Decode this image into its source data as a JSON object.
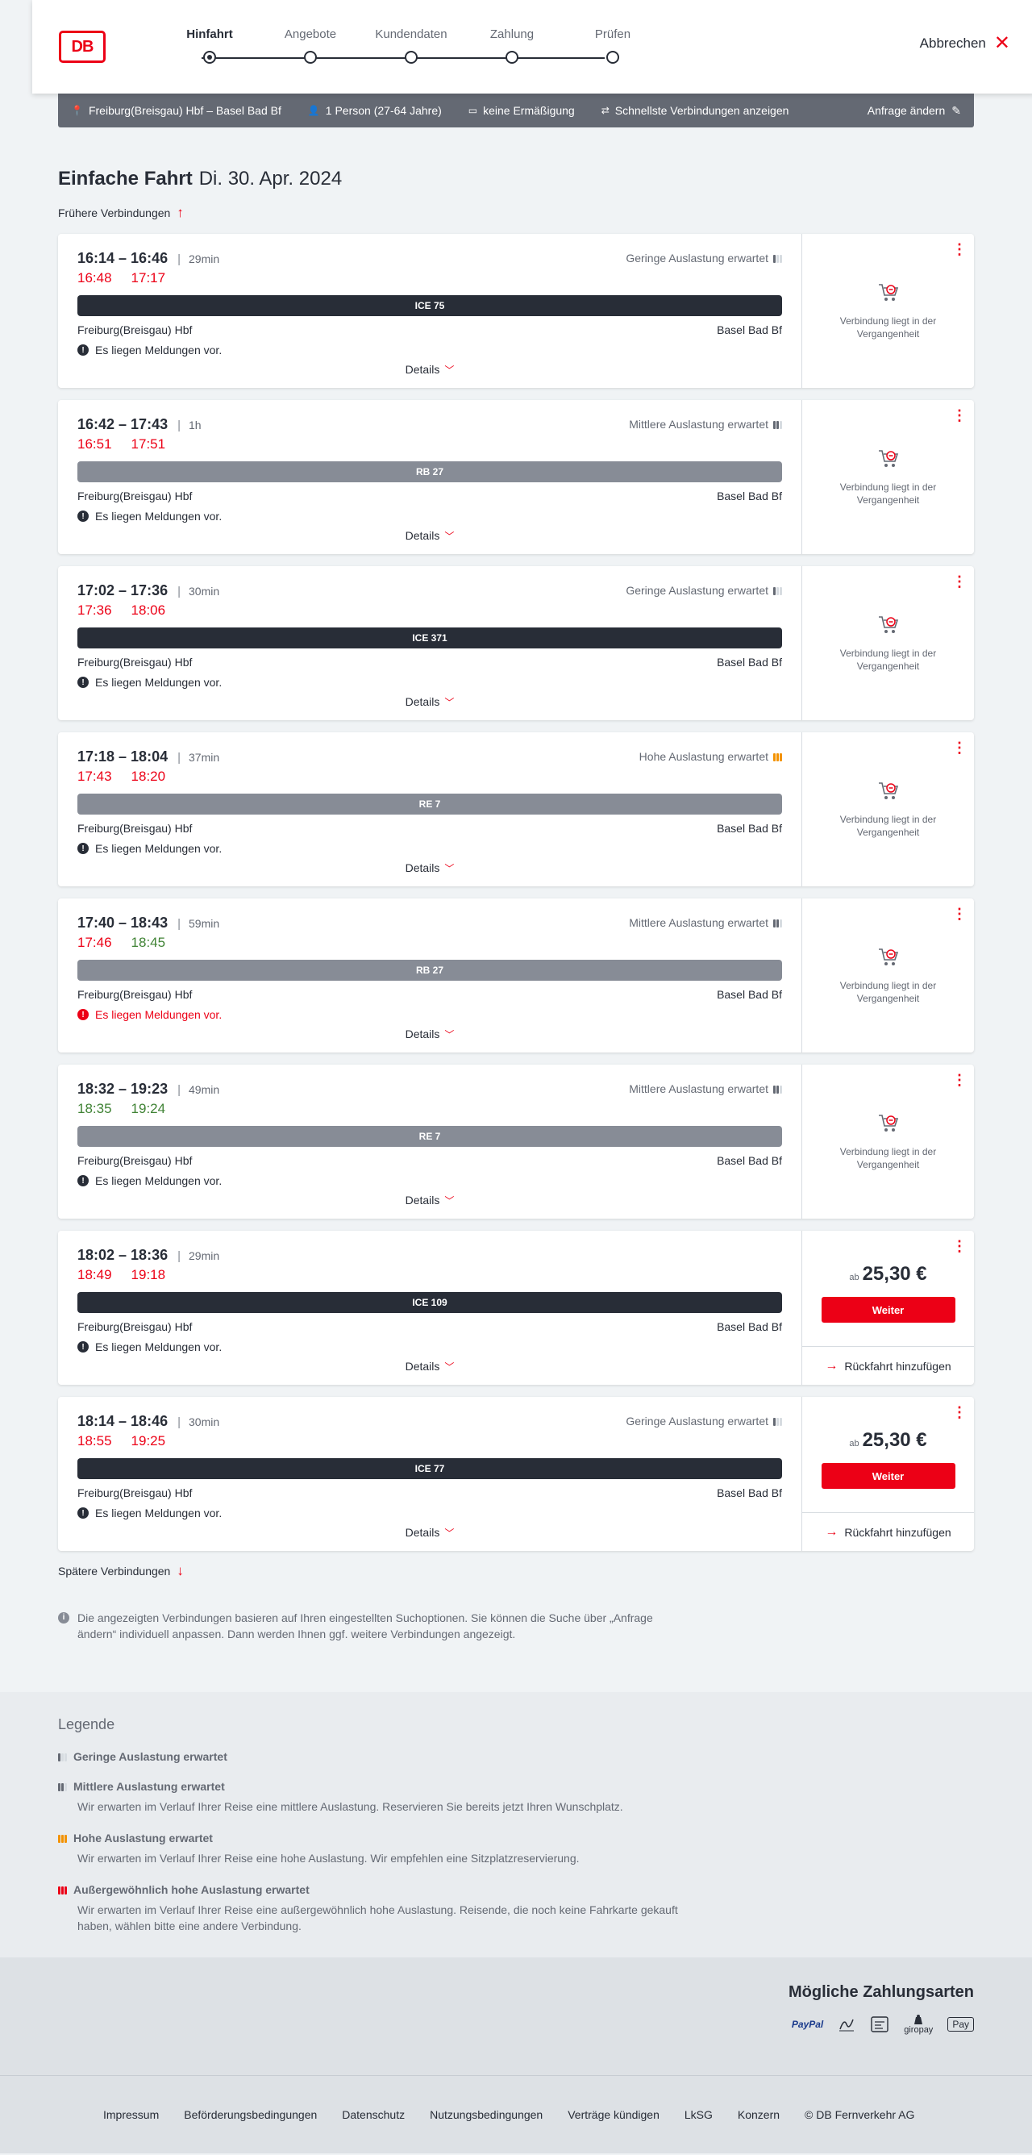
{
  "header": {
    "logo": "DB",
    "steps": [
      {
        "label": "Hinfahrt",
        "active": true
      },
      {
        "label": "Angebote",
        "active": false
      },
      {
        "label": "Kundendaten",
        "active": false
      },
      {
        "label": "Zahlung",
        "active": false
      },
      {
        "label": "Prüfen",
        "active": false
      }
    ],
    "cancel_label": "Abbrechen"
  },
  "search_bar": {
    "route": "Freiburg(Breisgau) Hbf – Basel Bad Bf",
    "passengers": "1 Person (27-64 Jahre)",
    "discount": "keine Ermäßigung",
    "fastest": "Schnellste Verbindungen anzeigen",
    "change": "Anfrage ändern"
  },
  "page": {
    "title": "Einfache Fahrt",
    "date": "Di. 30. Apr. 2024",
    "earlier": "Frühere Verbindungen",
    "later": "Spätere Verbindungen",
    "info": "Die angezeigten Verbindungen basieren auf Ihren eingestellten Suchoptionen. Sie können die Suche über „Anfrage ändern“ individuell anpassen. Dann werden Ihnen ggf. weitere Verbindungen angezeigt."
  },
  "colors": {
    "accent": "#ec0016",
    "dark": "#282d37",
    "grey_train": "#878c96",
    "on_time": "#408335",
    "high_load": "#f39200"
  },
  "connections": [
    {
      "time": "16:14 – 16:46",
      "duration": "29min",
      "rt_dep": "16:48",
      "rt_arr": "17:17",
      "dep_color": "red",
      "arr_color": "red",
      "occupancy": "Geringe Auslastung erwartet",
      "occ_level": 1,
      "train": "ICE 75",
      "train_style": "dark",
      "from": "Freiburg(Breisgau) Hbf",
      "to": "Basel Bad Bf",
      "message": "Es liegen Meldungen vor.",
      "message_alert": false,
      "details": "Details",
      "status": "Verbindung liegt in der Vergangenheit"
    },
    {
      "time": "16:42 – 17:43",
      "duration": "1h",
      "rt_dep": "16:51",
      "rt_arr": "17:51",
      "dep_color": "red",
      "arr_color": "red",
      "occupancy": "Mittlere Auslastung erwartet",
      "occ_level": 2,
      "train": "RB 27",
      "train_style": "grey",
      "from": "Freiburg(Breisgau) Hbf",
      "to": "Basel Bad Bf",
      "message": "Es liegen Meldungen vor.",
      "message_alert": false,
      "details": "Details",
      "status": "Verbindung liegt in der Vergangenheit"
    },
    {
      "time": "17:02 – 17:36",
      "duration": "30min",
      "rt_dep": "17:36",
      "rt_arr": "18:06",
      "dep_color": "red",
      "arr_color": "red",
      "occupancy": "Geringe Auslastung erwartet",
      "occ_level": 1,
      "train": "ICE 371",
      "train_style": "dark",
      "from": "Freiburg(Breisgau) Hbf",
      "to": "Basel Bad Bf",
      "message": "Es liegen Meldungen vor.",
      "message_alert": false,
      "details": "Details",
      "status": "Verbindung liegt in der Vergangenheit"
    },
    {
      "time": "17:18 – 18:04",
      "duration": "37min",
      "rt_dep": "17:43",
      "rt_arr": "18:20",
      "dep_color": "red",
      "arr_color": "red",
      "occupancy": "Hohe Auslastung erwartet",
      "occ_level": 3,
      "train": "RE 7",
      "train_style": "grey",
      "from": "Freiburg(Breisgau) Hbf",
      "to": "Basel Bad Bf",
      "message": "Es liegen Meldungen vor.",
      "message_alert": false,
      "details": "Details",
      "status": "Verbindung liegt in der Vergangenheit"
    },
    {
      "time": "17:40 – 18:43",
      "duration": "59min",
      "rt_dep": "17:46",
      "rt_arr": "18:45",
      "dep_color": "red",
      "arr_color": "grn",
      "occupancy": "Mittlere Auslastung erwartet",
      "occ_level": 2,
      "train": "RB 27",
      "train_style": "grey",
      "from": "Freiburg(Breisgau) Hbf",
      "to": "Basel Bad Bf",
      "message": "Es liegen Meldungen vor.",
      "message_alert": true,
      "details": "Details",
      "status": "Verbindung liegt in der Vergangenheit"
    },
    {
      "time": "18:32 – 19:23",
      "duration": "49min",
      "rt_dep": "18:35",
      "rt_arr": "19:24",
      "dep_color": "grn",
      "arr_color": "grn",
      "occupancy": "Mittlere Auslastung erwartet",
      "occ_level": 2,
      "train": "RE 7",
      "train_style": "grey",
      "from": "Freiburg(Breisgau) Hbf",
      "to": "Basel Bad Bf",
      "message": "Es liegen Meldungen vor.",
      "message_alert": false,
      "details": "Details",
      "status": "Verbindung liegt in der Vergangenheit"
    },
    {
      "time": "18:02 – 18:36",
      "duration": "29min",
      "rt_dep": "18:49",
      "rt_arr": "19:18",
      "dep_color": "red",
      "arr_color": "red",
      "occupancy": "",
      "occ_level": 0,
      "train": "ICE 109",
      "train_style": "dark",
      "from": "Freiburg(Breisgau) Hbf",
      "to": "Basel Bad Bf",
      "message": "Es liegen Meldungen vor.",
      "message_alert": false,
      "details": "Details",
      "price_prefix": "ab",
      "price": "25,30 €",
      "button": "Weiter",
      "return_trip": "Rückfahrt hinzufügen"
    },
    {
      "time": "18:14 – 18:46",
      "duration": "30min",
      "rt_dep": "18:55",
      "rt_arr": "19:25",
      "dep_color": "red",
      "arr_color": "red",
      "occupancy": "Geringe Auslastung erwartet",
      "occ_level": 1,
      "train": "ICE 77",
      "train_style": "dark",
      "from": "Freiburg(Breisgau) Hbf",
      "to": "Basel Bad Bf",
      "message": "Es liegen Meldungen vor.",
      "message_alert": false,
      "details": "Details",
      "price_prefix": "ab",
      "price": "25,30 €",
      "button": "Weiter",
      "return_trip": "Rückfahrt hinzufügen"
    }
  ],
  "legend": {
    "title": "Legende",
    "items": [
      {
        "level": 1,
        "title": "Geringe Auslastung erwartet",
        "desc": ""
      },
      {
        "level": 2,
        "title": "Mittlere Auslastung erwartet",
        "desc": "Wir erwarten im Verlauf Ihrer Reise eine mittlere Auslastung. Reservieren Sie bereits jetzt Ihren Wunschplatz."
      },
      {
        "level": 3,
        "title": "Hohe Auslastung erwartet",
        "desc": "Wir erwarten im Verlauf Ihrer Reise eine hohe Auslastung. Wir empfehlen eine Sitzplatzreservierung."
      },
      {
        "level": 4,
        "title": "Außergewöhnlich hohe Auslastung erwartet",
        "desc": "Wir erwarten im Verlauf Ihrer Reise eine außergewöhnlich hohe Auslastung. Reisende, die noch keine Fahrkarte gekauft haben, wählen bitte eine andere Verbindung."
      }
    ]
  },
  "payment": {
    "title": "Mögliche Zahlungsarten",
    "methods": [
      {
        "icon": "paypal-icon",
        "label": "PayPal"
      },
      {
        "icon": "sepa-icon",
        "label": ""
      },
      {
        "icon": "invoice-icon",
        "label": ""
      },
      {
        "icon": "giropay-icon",
        "label": "giropay"
      },
      {
        "icon": "applepay-icon",
        "label": "Pay"
      }
    ]
  },
  "footer": {
    "links": [
      "Impressum",
      "Beförderungsbedingungen",
      "Datenschutz",
      "Nutzungsbedingungen",
      "Verträge kündigen",
      "LkSG",
      "Konzern",
      "© DB Fernverkehr AG"
    ]
  }
}
